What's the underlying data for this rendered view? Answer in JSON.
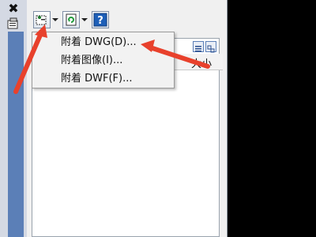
{
  "window": {
    "close_glyph": "✖"
  },
  "toolbar": {
    "attach_button_icon": "attach-dwg-icon",
    "refresh_button_icon": "refresh-icon",
    "help_button_icon": "help-icon"
  },
  "list": {
    "column_header": "大小"
  },
  "menu": {
    "items": [
      {
        "label": "附着 DWG(D)..."
      },
      {
        "label": "附着图像(I)..."
      },
      {
        "label": "附着 DWF(F)..."
      }
    ]
  },
  "colors": {
    "annotation_arrow": "#e8412c",
    "sidebar_blue": "#5b7fb7"
  }
}
